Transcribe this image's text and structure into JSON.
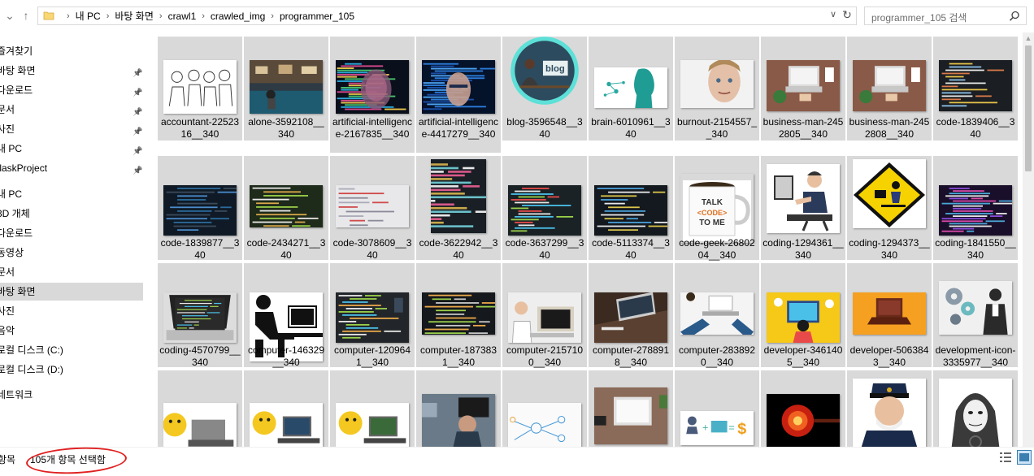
{
  "addressbar": {
    "breadcrumbs": [
      "내 PC",
      "바탕 화면",
      "crawl1",
      "crawled_img",
      "programmer_105"
    ],
    "search_placeholder": "programmer_105 검색"
  },
  "nav": {
    "items": [
      {
        "label": "즐겨찾기",
        "pinned": false,
        "selected": false
      },
      {
        "label": "바탕 화면",
        "pinned": true,
        "selected": false
      },
      {
        "label": "다운로드",
        "pinned": true,
        "selected": false
      },
      {
        "label": "문서",
        "pinned": true,
        "selected": false
      },
      {
        "label": "사진",
        "pinned": true,
        "selected": false
      },
      {
        "label": "내 PC",
        "pinned": true,
        "selected": false
      },
      {
        "label": "flaskProject",
        "pinned": true,
        "selected": false
      },
      {
        "label": "내 PC",
        "pinned": false,
        "selected": false
      },
      {
        "label": "3D 개체",
        "pinned": false,
        "selected": false
      },
      {
        "label": "다운로드",
        "pinned": false,
        "selected": false
      },
      {
        "label": "동영상",
        "pinned": false,
        "selected": false
      },
      {
        "label": "문서",
        "pinned": false,
        "selected": false
      },
      {
        "label": "바탕 화면",
        "pinned": false,
        "selected": true
      },
      {
        "label": "사진",
        "pinned": false,
        "selected": false
      },
      {
        "label": "음악",
        "pinned": false,
        "selected": false
      },
      {
        "label": "로컬 디스크 (C:)",
        "pinned": false,
        "selected": false
      },
      {
        "label": "로컬 디스크 (D:)",
        "pinned": false,
        "selected": false
      },
      {
        "label": "네트워크",
        "pinned": false,
        "selected": false
      }
    ]
  },
  "files": [
    {
      "name": "accountant-2252316__340",
      "thumb": "sketch"
    },
    {
      "name": "alone-3592108__340",
      "thumb": "cafe"
    },
    {
      "name": "artificial-intelligence-2167835__340",
      "thumb": "ai-face"
    },
    {
      "name": "artificial-intelligence-4417279__340",
      "thumb": "ai-face2"
    },
    {
      "name": "blog-3596548__340",
      "thumb": "blog"
    },
    {
      "name": "brain-6010961__340",
      "thumb": "brain"
    },
    {
      "name": "burnout-2154557__340",
      "thumb": "burnout"
    },
    {
      "name": "business-man-2452805__340",
      "thumb": "laptop-wood"
    },
    {
      "name": "business-man-2452808__340",
      "thumb": "laptop-wood"
    },
    {
      "name": "code-1839406__340",
      "thumb": "code-dark"
    },
    {
      "name": "code-1839877__340",
      "thumb": "code-blur"
    },
    {
      "name": "code-2434271__340",
      "thumb": "code-green"
    },
    {
      "name": "code-3078609__340",
      "thumb": "code-paper"
    },
    {
      "name": "code-3622942__340",
      "thumb": "code-tall"
    },
    {
      "name": "code-3637299__340",
      "thumb": "code-color"
    },
    {
      "name": "code-5113374__340",
      "thumb": "code-dark2"
    },
    {
      "name": "code-geek-2680204__340",
      "thumb": "mug"
    },
    {
      "name": "coding-1294361__340",
      "thumb": "cartoon-coder"
    },
    {
      "name": "coding-1294373__340",
      "thumb": "sign"
    },
    {
      "name": "coding-1841550__340",
      "thumb": "code-purple"
    },
    {
      "name": "coding-4570799__340",
      "thumb": "laptop-code"
    },
    {
      "name": "computer-146329__340",
      "thumb": "pictogram"
    },
    {
      "name": "computer-1209641__340",
      "thumb": "code-monitor"
    },
    {
      "name": "computer-1873831__340",
      "thumb": "code-dark3"
    },
    {
      "name": "computer-2157100__340",
      "thumb": "retro"
    },
    {
      "name": "computer-2788918__340",
      "thumb": "desk-laptop"
    },
    {
      "name": "computer-2838920__340",
      "thumb": "hands"
    },
    {
      "name": "developer-3461405__340",
      "thumb": "dev-yellow"
    },
    {
      "name": "developer-5063843__340",
      "thumb": "dev-orange"
    },
    {
      "name": "development-icon-3335977__340",
      "thumb": "gears"
    },
    {
      "name": "",
      "thumb": "emoji1"
    },
    {
      "name": "",
      "thumb": "emoji2"
    },
    {
      "name": "",
      "thumb": "emoji3"
    },
    {
      "name": "",
      "thumb": "office"
    },
    {
      "name": "",
      "thumb": "whiteboard"
    },
    {
      "name": "",
      "thumb": "desk-top"
    },
    {
      "name": "",
      "thumb": "equation"
    },
    {
      "name": "",
      "thumb": "fire"
    },
    {
      "name": "",
      "thumb": "captain"
    },
    {
      "name": "",
      "thumb": "hacker"
    }
  ],
  "status": {
    "item_count": "항목",
    "selected": "105개 항목 선택함"
  }
}
